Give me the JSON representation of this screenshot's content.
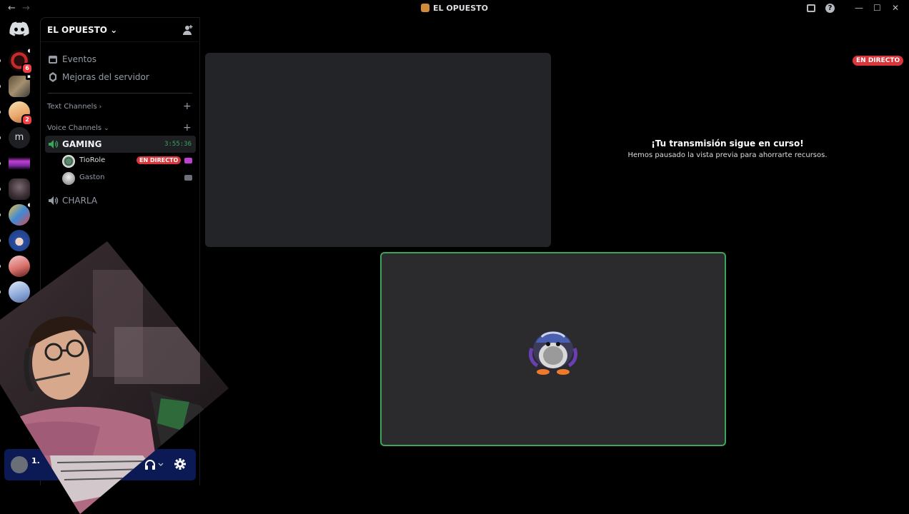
{
  "window": {
    "title": "EL OPUESTO",
    "back_glyph": "←",
    "forward_glyph": "→",
    "controls": {
      "help": "?",
      "minimize": "—",
      "maximize": "☐",
      "close": "✕"
    }
  },
  "rail": {
    "discord_home_icon": "discord-logo-icon",
    "servers": [
      {
        "name": "server-red-circle",
        "color": "#c62b2b",
        "badge": "6"
      },
      {
        "name": "server-mosaic",
        "color": "#8c7a5a",
        "badge": ""
      },
      {
        "name": "server-anime-blonde",
        "color": "#e8c38a",
        "badge": "2"
      },
      {
        "name": "server-m",
        "letter": "m",
        "badge": ""
      },
      {
        "name": "server-purple-text",
        "color": "#9b4ed6",
        "badge": ""
      },
      {
        "name": "server-dark-figure",
        "color": "#4a3f47",
        "badge": ""
      },
      {
        "name": "server-colorful",
        "color": "#3f8ad8",
        "badge": ""
      },
      {
        "name": "server-blue-hair",
        "color": "#3567b8",
        "badge": ""
      },
      {
        "name": "server-pink",
        "color": "#d88a8a",
        "badge": ""
      },
      {
        "name": "server-light-blue",
        "color": "#a8bde0",
        "badge": ""
      }
    ]
  },
  "server": {
    "name": "EL OPUESTO",
    "menu": [
      {
        "label": "Eventos",
        "icon": "calendar-icon"
      },
      {
        "label": "Mejoras del servidor",
        "icon": "boost-icon"
      }
    ],
    "categories": {
      "text": "Text Channels",
      "voice": "Voice Channels"
    },
    "voice_channels": [
      {
        "name": "GAMING",
        "time": "3:55:36",
        "members": [
          {
            "name": "TioRole",
            "live": "EN DIRECTO"
          },
          {
            "name": "Gaston"
          }
        ]
      },
      {
        "name": "CHARLA"
      }
    ]
  },
  "user_panel": {
    "name_partial": "1."
  },
  "stage": {
    "live_badge": "EN DIRECTO",
    "paused_title": "¡Tu transmisión sigue en curso!",
    "paused_sub": "Hemos pausado la vista previa para ahorrarte recursos."
  },
  "colors": {
    "accent_green": "#3ba55c",
    "live_red": "#da373c",
    "background": "#000000"
  }
}
